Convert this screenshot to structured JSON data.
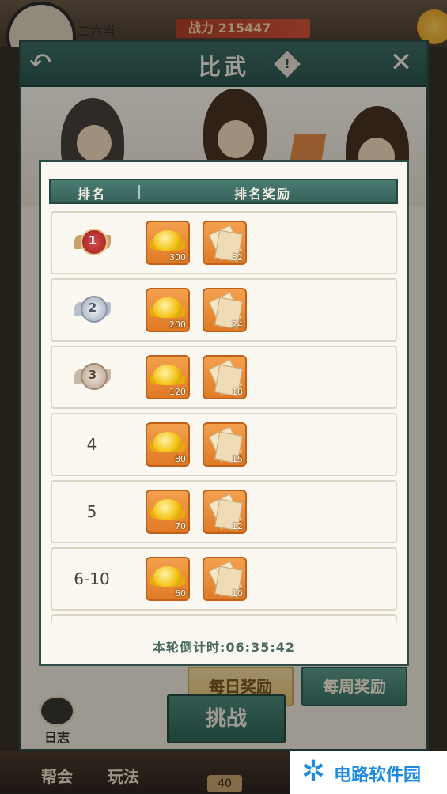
{
  "top_bar": {
    "player_name": "二六当",
    "power_label": "战力 215447"
  },
  "panel": {
    "title": "比武",
    "info_glyph": "!",
    "back_glyph": "↶",
    "close_glyph": "✕"
  },
  "reward_popup": {
    "col_rank": "排名",
    "col_reward": "排名奖励",
    "rows": [
      {
        "rank": "1",
        "medal": "gold",
        "gold": "300",
        "scroll": "32"
      },
      {
        "rank": "2",
        "medal": "silver",
        "gold": "200",
        "scroll": "24"
      },
      {
        "rank": "3",
        "medal": "bronze",
        "gold": "120",
        "scroll": "18"
      },
      {
        "rank": "4",
        "medal": null,
        "gold": "80",
        "scroll": "15"
      },
      {
        "rank": "5",
        "medal": null,
        "gold": "70",
        "scroll": "12"
      },
      {
        "rank": "6-10",
        "medal": null,
        "gold": "60",
        "scroll": "10"
      }
    ],
    "countdown": "本轮倒计时:06:35:42"
  },
  "tabs": {
    "daily": "每日奖励",
    "weekly": "每周奖励"
  },
  "challenge_label": "挑战",
  "log_label": "日志",
  "bottom_nav": {
    "guild": "帮会",
    "play": "玩法",
    "badge": "40"
  },
  "watermark": {
    "text": "电路软件园"
  },
  "colors": {
    "panel_header": "#2d5751",
    "reward_tile": "#e07a25",
    "daily_tab": "#f5dca0",
    "weekly_tab": "#3b7466"
  }
}
